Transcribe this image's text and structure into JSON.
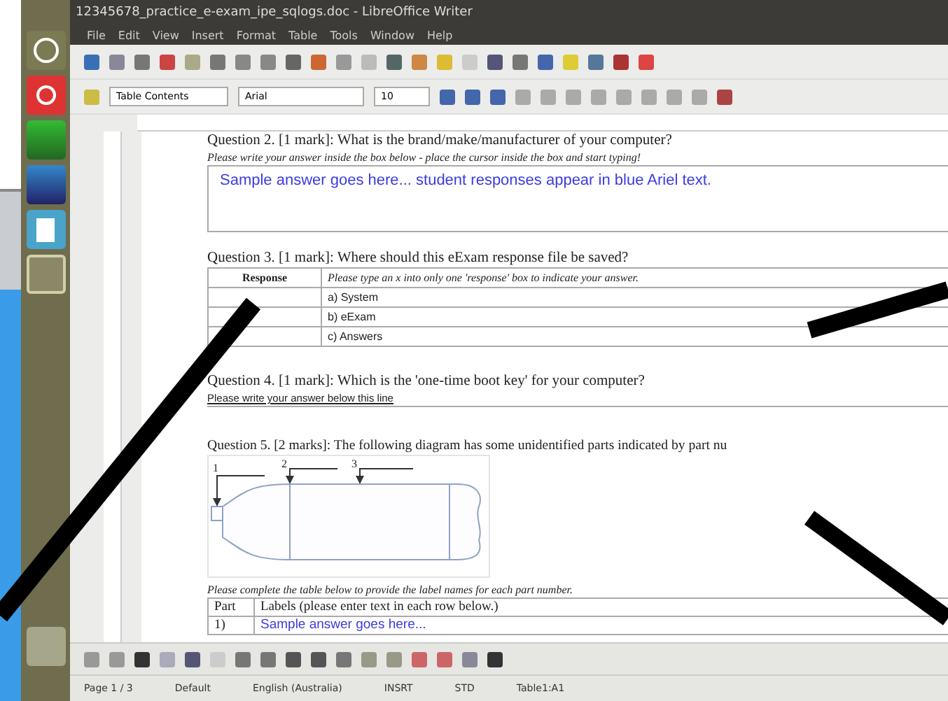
{
  "window": {
    "title": "12345678_practice_e-exam_ipe_sqlogs.doc - LibreOffice Writer"
  },
  "menu": [
    "File",
    "Edit",
    "View",
    "Insert",
    "Format",
    "Table",
    "Tools",
    "Window",
    "Help"
  ],
  "formatting_bar": {
    "style": "Table Contents",
    "font": "Arial",
    "size": "10"
  },
  "document": {
    "q2": {
      "question": "Question 2. [1 mark]: What is the brand/make/manufacturer of your computer?",
      "instruction": "Please write your answer inside the box below - place the cursor inside the box and start typing!",
      "answer": "Sample answer goes here... student responses appear in blue Ariel text."
    },
    "q3": {
      "question": "Question 3. [1 mark]: Where should this eExam response file be saved?",
      "columns": [
        "Response",
        "Please type an x into only one 'response' box to indicate your answer."
      ],
      "options": [
        "a) System",
        "b) eExam",
        "c) Answers"
      ]
    },
    "q4": {
      "question": "Question 4. [1 mark]: Which is the 'one-time boot key' for your computer?",
      "instruction": "Please write your answer below this line"
    },
    "q5": {
      "question": "Question 5. [2 marks]: The following diagram has some unidentified parts indicated by part nu",
      "part_numbers": [
        "1",
        "2",
        "3"
      ],
      "instruction": "Please complete the table below to provide the label names for each part number.",
      "columns": [
        "Part",
        "Labels (please enter text in each row below.)"
      ],
      "rows": [
        {
          "part": "1)",
          "label": "Sample answer goes here..."
        }
      ]
    }
  },
  "status_bar": {
    "page": "Page 1 / 3",
    "style": "Default",
    "language": "English (Australia)",
    "mode": "INSRT",
    "selection": "STD",
    "cell": "Table1:A1"
  }
}
